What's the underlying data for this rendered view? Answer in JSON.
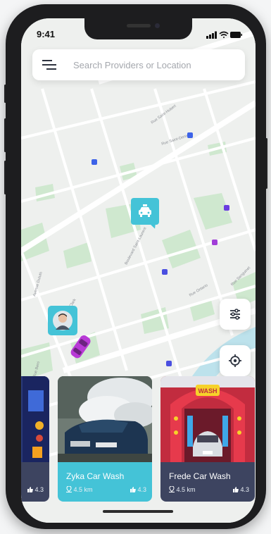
{
  "status_bar": {
    "time": "9:41"
  },
  "search": {
    "placeholder": "Search Providers or Location",
    "value": ""
  },
  "map": {
    "streets": [
      "Rue Saint-Hubert",
      "Boulevard Saint-Laurent",
      "Rue Ontario",
      "Rue Clark",
      "Rue Sanguinet",
      "Rue Saint-Denis",
      "Avenue Duluth",
      "Rue Berri"
    ]
  },
  "providers": [
    {
      "name": "",
      "distance": "",
      "rating": "4.3",
      "color": "#3d4460"
    },
    {
      "name": "Zyka Car Wash",
      "distance": "4.5 km",
      "rating": "4.3",
      "color": "#44c3d7"
    },
    {
      "name": "Frede Car Wash",
      "distance": "4.5 km",
      "rating": "4.3",
      "color": "#3d4460"
    }
  ],
  "colors": {
    "accent": "#44c3d7",
    "pin_blue": "#3d63e8",
    "pin_purple": "#7a3de0",
    "car": "#b83ad6"
  },
  "icons": [
    "menu-icon",
    "filter-icon",
    "locate-icon",
    "taxi-icon",
    "location-icon",
    "thumbs-up-icon"
  ]
}
